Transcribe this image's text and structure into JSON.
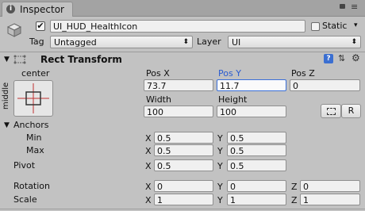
{
  "tab": {
    "title": "Inspector"
  },
  "header": {
    "object_name": "UI_HUD_HealthIcon",
    "static_label": "Static",
    "tag_label": "Tag",
    "tag_value": "Untagged",
    "layer_label": "Layer",
    "layer_value": "UI"
  },
  "rect_transform": {
    "title": "Rect Transform",
    "anchor_preset_h": "center",
    "anchor_preset_v": "middle",
    "col_headers": [
      "Pos X",
      "Pos Y",
      "Pos Z"
    ],
    "values": [
      "73.7",
      "11.7",
      "0"
    ],
    "size_headers": [
      "Width",
      "Height"
    ],
    "size_values": [
      "100",
      "100"
    ],
    "blueprint_label": "",
    "raw_label": "R"
  },
  "anchors": {
    "title": "Anchors",
    "min_label": "Min",
    "min_x": "0.5",
    "min_y": "0.5",
    "max_label": "Max",
    "max_x": "0.5",
    "max_y": "0.5"
  },
  "pivot": {
    "label": "Pivot",
    "x": "0.5",
    "y": "0.5"
  },
  "rotation": {
    "label": "Rotation",
    "x": "0",
    "y": "0",
    "z": "0"
  },
  "scale": {
    "label": "Scale",
    "x": "1",
    "y": "1",
    "z": "1"
  },
  "axis": {
    "x": "X",
    "y": "Y",
    "z": "Z"
  }
}
